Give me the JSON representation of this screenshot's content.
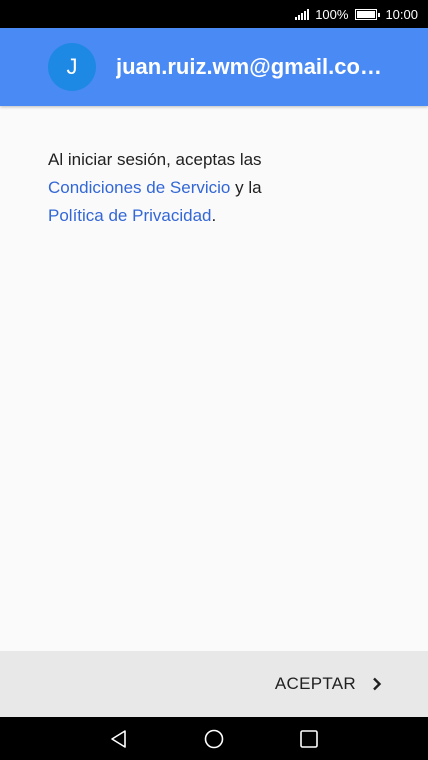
{
  "status_bar": {
    "battery": "100%",
    "time": "10:00"
  },
  "header": {
    "avatar_letter": "J",
    "email": "juan.ruiz.wm@gmail.co…"
  },
  "terms": {
    "intro": "Al iniciar sesión, aceptas las",
    "terms_link": "Condiciones de Servicio",
    "connector": "y la",
    "privacy_link": "Política de Privacidad",
    "end": "."
  },
  "actions": {
    "accept_label": "ACEPTAR"
  },
  "colors": {
    "header": "#4a8af4",
    "avatar": "#1e88e5",
    "link": "#3367d6",
    "action_bar": "#e8e8e8"
  }
}
